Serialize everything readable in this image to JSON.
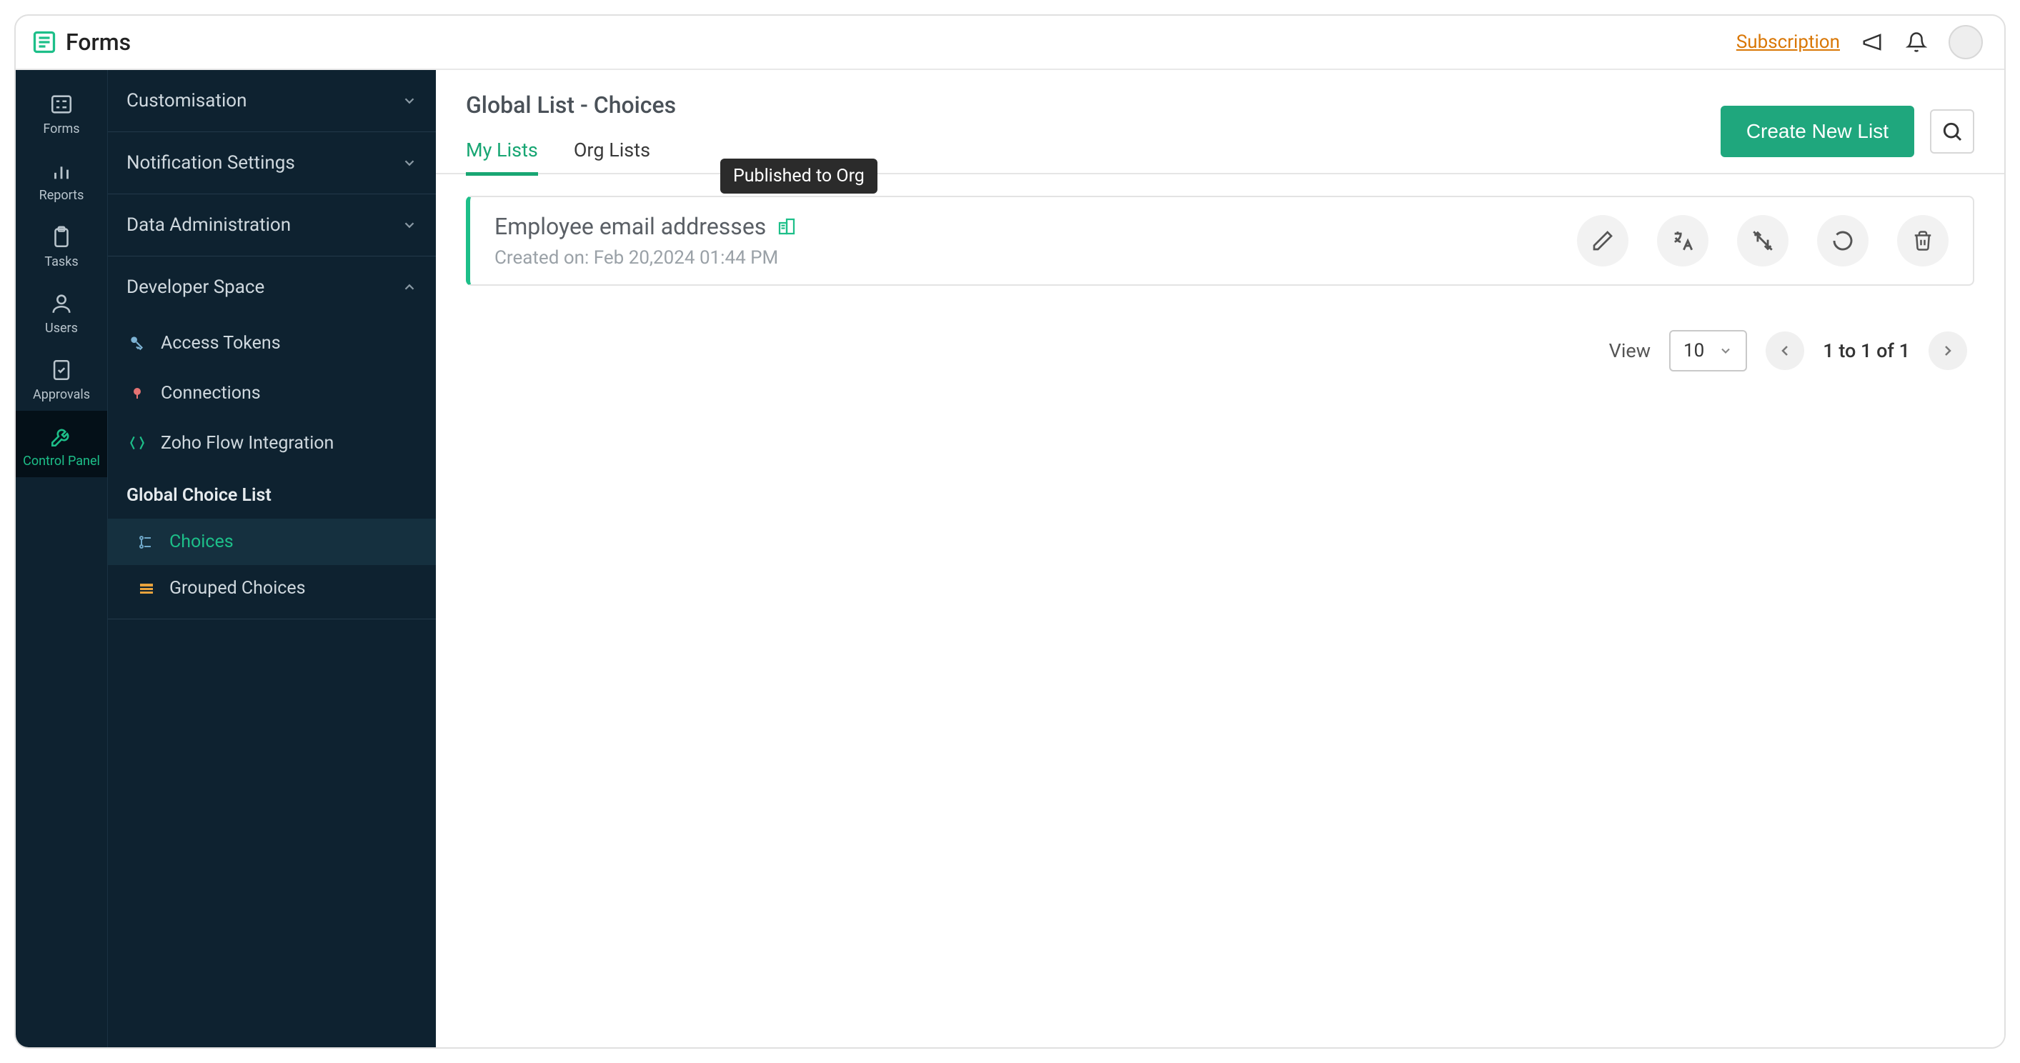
{
  "brand": {
    "name": "Forms"
  },
  "topbar": {
    "subscription_label": "Subscription"
  },
  "rail": {
    "items": [
      {
        "label": "Forms"
      },
      {
        "label": "Reports"
      },
      {
        "label": "Tasks"
      },
      {
        "label": "Users"
      },
      {
        "label": "Approvals"
      },
      {
        "label": "Control Panel"
      }
    ]
  },
  "sidenav": {
    "sections": [
      {
        "title": "Customisation"
      },
      {
        "title": "Notification Settings"
      },
      {
        "title": "Data Administration"
      },
      {
        "title": "Developer Space"
      }
    ],
    "dev_items": [
      {
        "label": "Access Tokens"
      },
      {
        "label": "Connections"
      },
      {
        "label": "Zoho Flow Integration"
      }
    ],
    "group_title": "Global Choice List",
    "leaves": [
      {
        "label": "Choices"
      },
      {
        "label": "Grouped Choices"
      }
    ]
  },
  "main": {
    "title": "Global List - Choices",
    "tabs": [
      {
        "label": "My Lists"
      },
      {
        "label": "Org Lists"
      }
    ],
    "create_button": "Create New List",
    "tooltip": "Published to Org",
    "card": {
      "title": "Employee email addresses",
      "subtitle": "Created on: Feb 20,2024 01:44 PM"
    },
    "pagination": {
      "view_label": "View",
      "page_size": "10",
      "range": "1 to 1 of 1"
    }
  }
}
